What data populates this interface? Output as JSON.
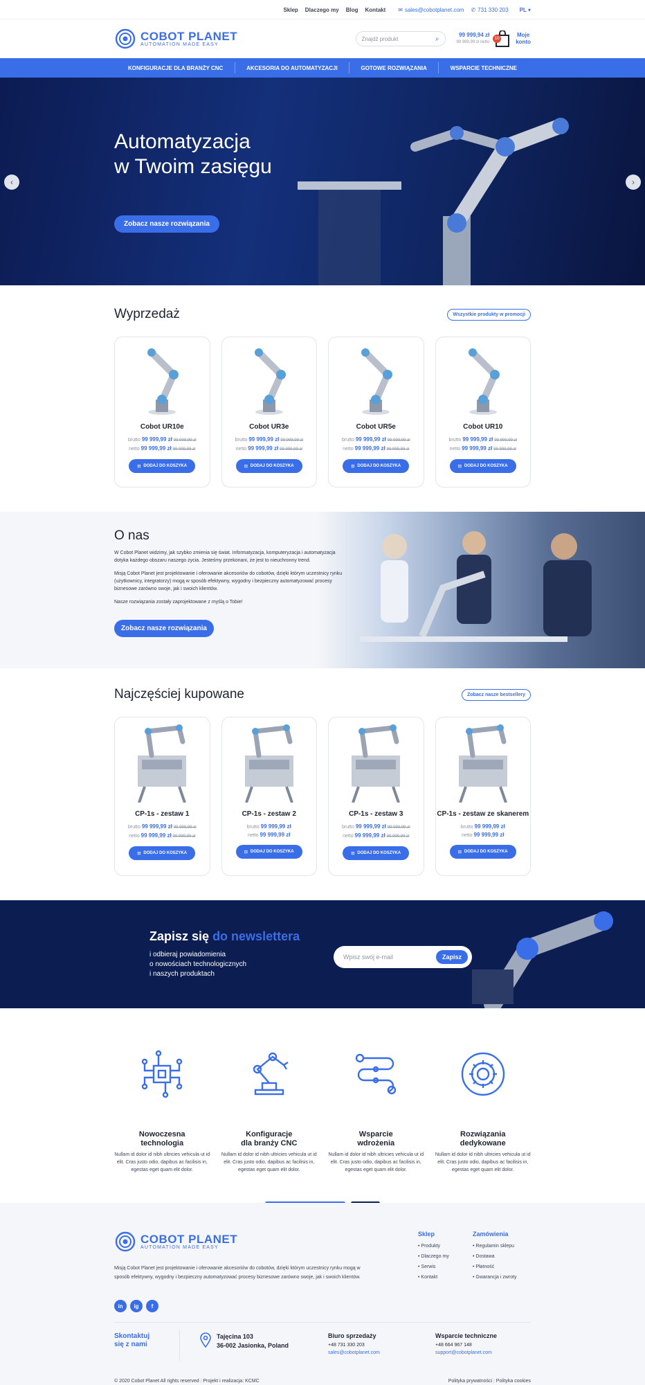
{
  "topbar": {
    "links": [
      "Sklep",
      "Dlaczego my",
      "Blog",
      "Kontakt"
    ],
    "email": "sales@cobotplanet.com",
    "phone": "731 330 203",
    "lang": "PL"
  },
  "header": {
    "logo_title": "COBOT PLANET",
    "logo_tagline": "AUTOMATION MADE EASY",
    "search_placeholder": "Znajdź produkt",
    "cart_gross": "99 999,94 zł",
    "cart_net": "99 999,99 zł netto",
    "cart_count": "10",
    "account_line1": "Moje",
    "account_line2": "konto"
  },
  "nav": [
    "KONFIGURACJE DLA BRANŻY CNC",
    "AKCESORIA DO AUTOMATYZACJI",
    "GOTOWE ROZWIĄZANIA",
    "WSPARCIE TECHNICZNE"
  ],
  "hero": {
    "title_line1": "Automatyzacja",
    "title_line2": "w Twoim zasięgu",
    "button": "Zobacz nasze rozwiązania"
  },
  "sale": {
    "title": "Wyprzedaż",
    "all_link": "Wszystkie produkty w promocji",
    "label_gross": "brutto",
    "label_net": "netto",
    "add_label": "DODAJ DO KOSZYKA",
    "products": [
      {
        "name": "Cobot UR10e",
        "gross": "99 999,99 zł",
        "gross_old": "99 999,99 zł",
        "net": "99 999,99 zł",
        "net_old": "99 999,99 zł"
      },
      {
        "name": "Cobot UR3e",
        "gross": "99 999,99 zł",
        "gross_old": "99 999,99 zł",
        "net": "99 999,99 zł",
        "net_old": "99 999,99 zł"
      },
      {
        "name": "Cobot UR5e",
        "gross": "99 999,99 zł",
        "gross_old": "99 999,99 zł",
        "net": "99 999,99 zł",
        "net_old": "99 999,99 zł"
      },
      {
        "name": "Cobot UR10",
        "gross": "99 999,99 zł",
        "gross_old": "99 999,99 zł",
        "net": "99 999,99 zł",
        "net_old": "99 999,99 zł"
      }
    ]
  },
  "about": {
    "title": "O nas",
    "p1": "W Cobot Planet widzimy, jak szybko zmienia się świat. Informatyzacja, komputeryzacja i automatyzacja dotyka każdego obszaru naszego życia. Jesteśmy przekonani, że jest to nieuchronny trend.",
    "p2": "Misją Cobot Planet jest projektowanie i oferowanie akcesoriów do cobotów, dzięki którym uczestnicy rynku (użytkownicy, integratorzy) mogą w sposób efektywny, wygodny i bezpieczny automatyzować procesy biznesowe zarówno swoje, jak i swoich klientów.",
    "p3": "Nasze rozwiązania zostały zaprojektowane z myślą o Tobie!",
    "button": "Zobacz nasze rozwiązania"
  },
  "bestsellers": {
    "title": "Najczęściej kupowane",
    "all_link": "Zobacz nasze bestsellery",
    "products": [
      {
        "name": "CP-1s - zestaw 1",
        "gross": "99 999,99 zł",
        "gross_old": "99 999,99 zł",
        "net": "99 999,99 zł",
        "net_old": "99 999,99 zł"
      },
      {
        "name": "CP-1s - zestaw 2",
        "gross": "99 999,99 zł",
        "gross_old": "",
        "net": "99 999,99 zł",
        "net_old": ""
      },
      {
        "name": "CP-1s - zestaw 3",
        "gross": "99 999,99 zł",
        "gross_old": "99 999,99 zł",
        "net": "99 999,99 zł",
        "net_old": "99 999,99 zł"
      },
      {
        "name": "CP-1s - zestaw ze skanerem",
        "gross": "99 999,99 zł",
        "gross_old": "",
        "net": "99 999,99 zł",
        "net_old": ""
      }
    ]
  },
  "newsletter": {
    "title_a": "Zapisz się",
    "title_b": "do newslettera",
    "line1": "i odbieraj powiadomienia",
    "line2": "o nowościach technologicznych",
    "line3": "i naszych produktach",
    "placeholder": "Wpisz swój e-mail",
    "button": "Zapisz"
  },
  "features": [
    {
      "title1": "Nowoczesna",
      "title2": "technologia",
      "text": "Nullam id dolor id nibh ultricies vehicula ut id elit. Cras justo odio, dapibus ac facilisis in, egestas eget quam elit dolor.",
      "icon": "chip-icon"
    },
    {
      "title1": "Konfiguracje",
      "title2": "dla branży CNC",
      "text": "Nullam id dolor id nibh ultricies vehicula ut id elit. Cras justo odio, dapibus ac facilisis in, egestas eget quam elit dolor.",
      "icon": "robot-arm-icon"
    },
    {
      "title1": "Wsparcie",
      "title2": "wdrożenia",
      "text": "Nullam id dolor id nibh ultricies vehicula ut id elit. Cras justo odio, dapibus ac facilisis in, egestas eget quam elit dolor.",
      "icon": "workflow-icon"
    },
    {
      "title1": "Rozwiązania",
      "title2": "dedykowane",
      "text": "Nullam id dolor id nibh ultricies vehicula ut id elit. Cras justo odio, dapibus ac facilisis in, egestas eget quam elit dolor.",
      "icon": "gear-icon"
    }
  ],
  "footer": {
    "logo_title": "COBOT PLANET",
    "logo_tagline": "AUTOMATION MADE EASY",
    "desc": "Misją Cobot Planet jest projektowanie i oferowanie akcesoriów do cobotów, dzięki którym uczestnicy rynku mogą w sposób efektywny, wygodny i bezpieczny automatyzować procesy biznesowe zarówno swoje, jak i swoich klientów.",
    "social": [
      "in",
      "ig",
      "f"
    ],
    "shop_title": "Sklep",
    "shop_links": [
      "Produkty",
      "Dlaczego my",
      "Serwis",
      "Kontakt"
    ],
    "orders_title": "Zamówienia",
    "orders_links": [
      "Regulamin sklepu",
      "Dostawa",
      "Płatność",
      "Gwarancja i zwroty"
    ],
    "contact_title1": "Skontaktuj",
    "contact_title2": "się z nami",
    "address1": "Tajęcina 103",
    "address2": "36-002 Jasionka, Poland",
    "sales_title": "Biuro sprzedaży",
    "sales_phone": "+48 731 330 203",
    "sales_email": "sales@cobotplanet.com",
    "support_title": "Wsparcie techniczne",
    "support_phone": "+48 664 967 148",
    "support_email": "support@cobotplanet.com",
    "copyright": "© 2020 Cobot Planet All rights reserved",
    "credits": "Projekt i realizacja: KCMC",
    "privacy": "Polityka prywatności",
    "cookies": "Polityka cookies"
  },
  "colors": {
    "accent": "#3a6ee8",
    "navy": "#0c1d52"
  }
}
